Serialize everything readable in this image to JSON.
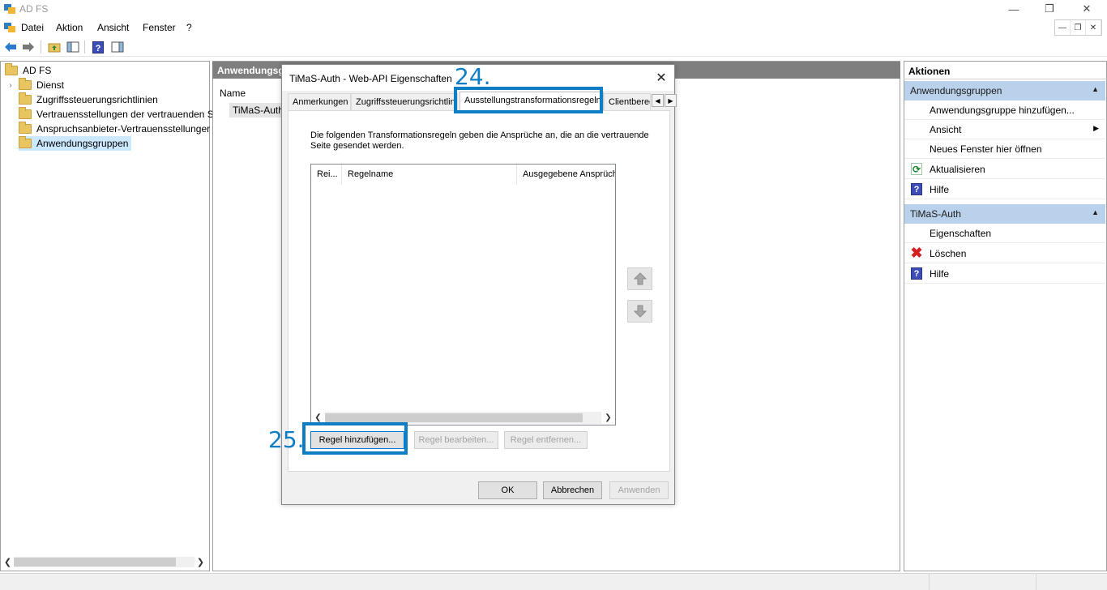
{
  "window": {
    "title": "AD FS"
  },
  "menu": [
    "Datei",
    "Aktion",
    "Ansicht",
    "Fenster",
    "?"
  ],
  "tree": {
    "root": "AD FS",
    "items": [
      {
        "label": "Dienst",
        "expandable": true
      },
      {
        "label": "Zugriffssteuerungsrichtlinien"
      },
      {
        "label": "Vertrauensstellungen der vertrauenden S"
      },
      {
        "label": "Anspruchsanbieter-Vertrauensstellunger"
      },
      {
        "label": "Anwendungsgruppen",
        "selected": true
      }
    ]
  },
  "middle": {
    "header": "Anwendungsg",
    "column": "Name",
    "item": "TiMaS-Auth"
  },
  "actions": {
    "title": "Aktionen",
    "group1": {
      "label": "Anwendungsgruppen",
      "items": [
        "Anwendungsgruppe hinzufügen...",
        "Ansicht",
        "Neues Fenster hier öffnen",
        "Aktualisieren",
        "Hilfe"
      ]
    },
    "group2": {
      "label": "TiMaS-Auth",
      "items": [
        "Eigenschaften",
        "Löschen",
        "Hilfe"
      ]
    }
  },
  "dialog": {
    "title": "TiMaS-Auth - Web-API Eigenschaften",
    "close": "✕",
    "tabs": [
      "Anmerkungen",
      "Zugriffssteuerungsrichtlinie",
      "Ausstellungstransformationsregeln",
      "Clientbered"
    ],
    "description": "Die folgenden Transformationsregeln geben die Ansprüche an, die an die vertrauende Seite gesendet werden.",
    "columns": [
      "Rei...",
      "Regelname",
      "Ausgegebene Ansprüch"
    ],
    "buttons": {
      "add": "Regel hinzufügen...",
      "edit": "Regel bearbeiten...",
      "remove": "Regel entfernen...",
      "ok": "OK",
      "cancel": "Abbrechen",
      "apply": "Anwenden"
    }
  },
  "annotations": {
    "step24": "24.",
    "step25": "25."
  },
  "colors": {
    "accent": "#0d7ec4",
    "groupHeader": "#b9d1ea",
    "selection": "#cce8ff"
  }
}
